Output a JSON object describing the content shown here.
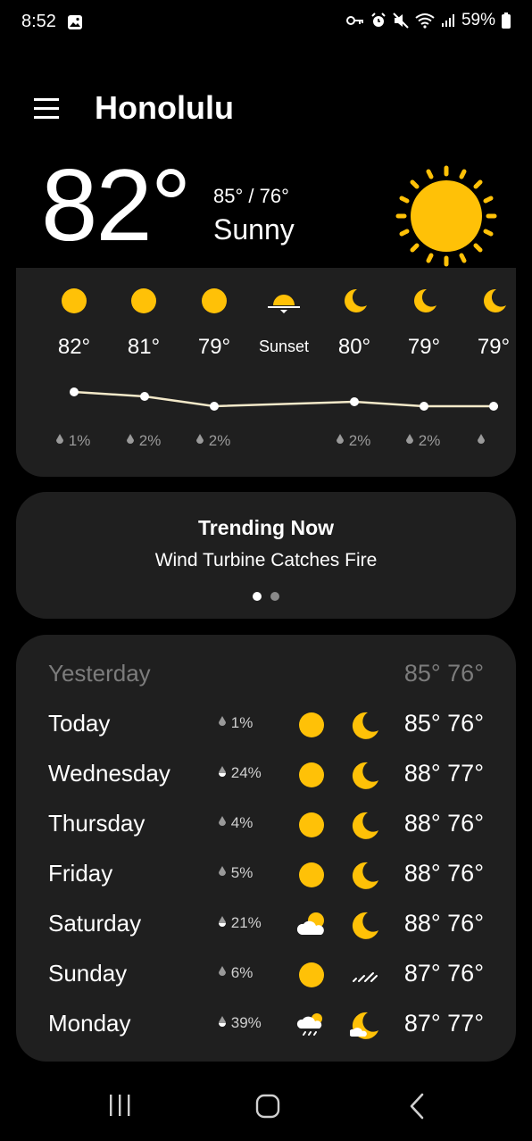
{
  "status": {
    "time": "8:52",
    "battery": "59%"
  },
  "header": {
    "city": "Honolulu",
    "menu_icon": "menu-icon"
  },
  "current": {
    "temp": "82°",
    "hi_lo": "85° / 76°",
    "condition": "Sunny",
    "icon": "sun-icon"
  },
  "hourly": [
    {
      "label": "82°",
      "icon": "sun-icon",
      "precip": "1%"
    },
    {
      "label": "81°",
      "icon": "sun-icon",
      "precip": "2%"
    },
    {
      "label": "79°",
      "icon": "sun-icon",
      "precip": "2%"
    },
    {
      "label": "Sunset",
      "icon": "sunset-icon",
      "precip": ""
    },
    {
      "label": "80°",
      "icon": "moon-icon",
      "precip": "2%"
    },
    {
      "label": "79°",
      "icon": "moon-icon",
      "precip": "2%"
    },
    {
      "label": "79°",
      "icon": "moon-icon",
      "precip": ""
    }
  ],
  "trending": {
    "title": "Trending Now",
    "text": "Wind Turbine Catches Fire"
  },
  "daily": [
    {
      "day": "Yesterday",
      "precip": "",
      "day_icon": "",
      "night_icon": "",
      "temps": "85° 76°"
    },
    {
      "day": "Today",
      "precip": "1%",
      "day_icon": "sun-icon",
      "night_icon": "moon-icon",
      "temps": "85° 76°"
    },
    {
      "day": "Wednesday",
      "precip": "24%",
      "day_icon": "sun-icon",
      "night_icon": "moon-icon",
      "temps": "88° 77°"
    },
    {
      "day": "Thursday",
      "precip": "4%",
      "day_icon": "sun-icon",
      "night_icon": "moon-icon",
      "temps": "88° 76°"
    },
    {
      "day": "Friday",
      "precip": "5%",
      "day_icon": "sun-icon",
      "night_icon": "moon-icon",
      "temps": "88° 76°"
    },
    {
      "day": "Saturday",
      "precip": "21%",
      "day_icon": "partly-cloudy-icon",
      "night_icon": "moon-icon",
      "temps": "88° 76°"
    },
    {
      "day": "Sunday",
      "precip": "6%",
      "day_icon": "sun-icon",
      "night_icon": "wind-icon",
      "temps": "87° 76°"
    },
    {
      "day": "Monday",
      "precip": "39%",
      "day_icon": "rain-cloud-icon",
      "night_icon": "cloudy-moon-icon",
      "temps": "87° 77°"
    }
  ],
  "colors": {
    "accent_yellow": "#FFC107",
    "card_bg": "#1f1f1f",
    "line": "#f3e9c9"
  }
}
